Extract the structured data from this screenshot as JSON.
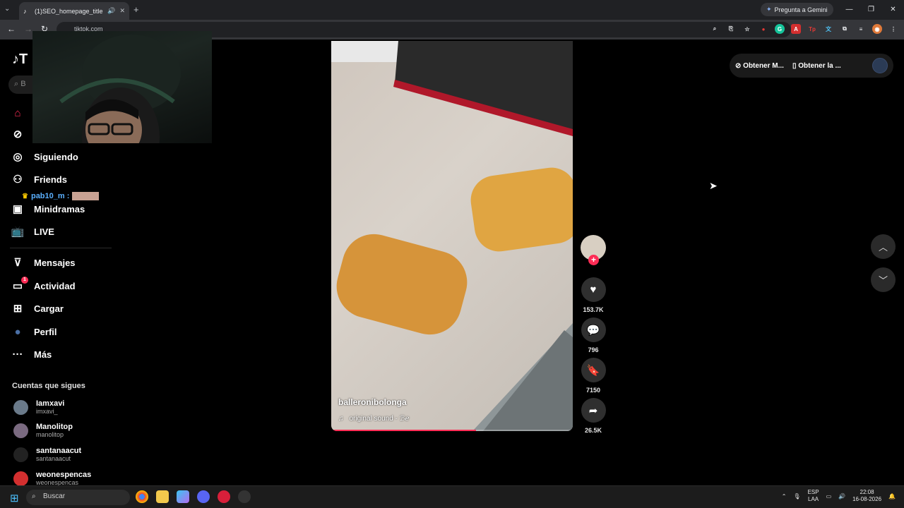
{
  "browser": {
    "tab_title": "(1)SEO_homepage_title",
    "url": "tiktok.com",
    "gemini_label": "Pregunta a Gemini"
  },
  "sidebar": {
    "search_placeholder": "B",
    "items": [
      {
        "label": "",
        "icon": "home-icon"
      },
      {
        "label": "",
        "icon": "explore-icon"
      },
      {
        "label": "Siguiendo",
        "icon": "following-icon"
      },
      {
        "label": "Friends",
        "icon": "friends-icon"
      },
      {
        "label": "Minidramas",
        "icon": "minidramas-icon"
      },
      {
        "label": "LIVE",
        "icon": "live-icon"
      },
      {
        "label": "Mensajes",
        "icon": "messages-icon"
      },
      {
        "label": "Actividad",
        "icon": "activity-icon",
        "badge": "1"
      },
      {
        "label": "Cargar",
        "icon": "upload-icon"
      },
      {
        "label": "Perfil",
        "icon": "profile-icon"
      },
      {
        "label": "Más",
        "icon": "more-icon"
      }
    ],
    "chat_overlay_user": "pab10_m :",
    "following_title": "Cuentas que sigues",
    "following": [
      {
        "name": "Iamxavi",
        "handle": "imxavi_"
      },
      {
        "name": "Manolitop",
        "handle": "manolitop"
      },
      {
        "name": "santanaacut",
        "handle": "santanaacut"
      },
      {
        "name": "weonespencas",
        "handle": "weonespencas"
      }
    ]
  },
  "video": {
    "author": "balleronibolonga",
    "sound": "original sound - ℬℯ",
    "progress_fraction": 0.6
  },
  "actions": {
    "likes": "153.7K",
    "comments": "796",
    "saves": "7150",
    "shares": "26.5K"
  },
  "top_right": {
    "pill1": "Obtener M...",
    "pill2": "Obtener la ..."
  },
  "taskbar": {
    "search": "Buscar",
    "lang_top": "ESP",
    "lang_bottom": "LAA",
    "time": "22:08",
    "date": "16-08-2026"
  },
  "colors": {
    "accent": "#fe2c55",
    "background": "#000000"
  }
}
